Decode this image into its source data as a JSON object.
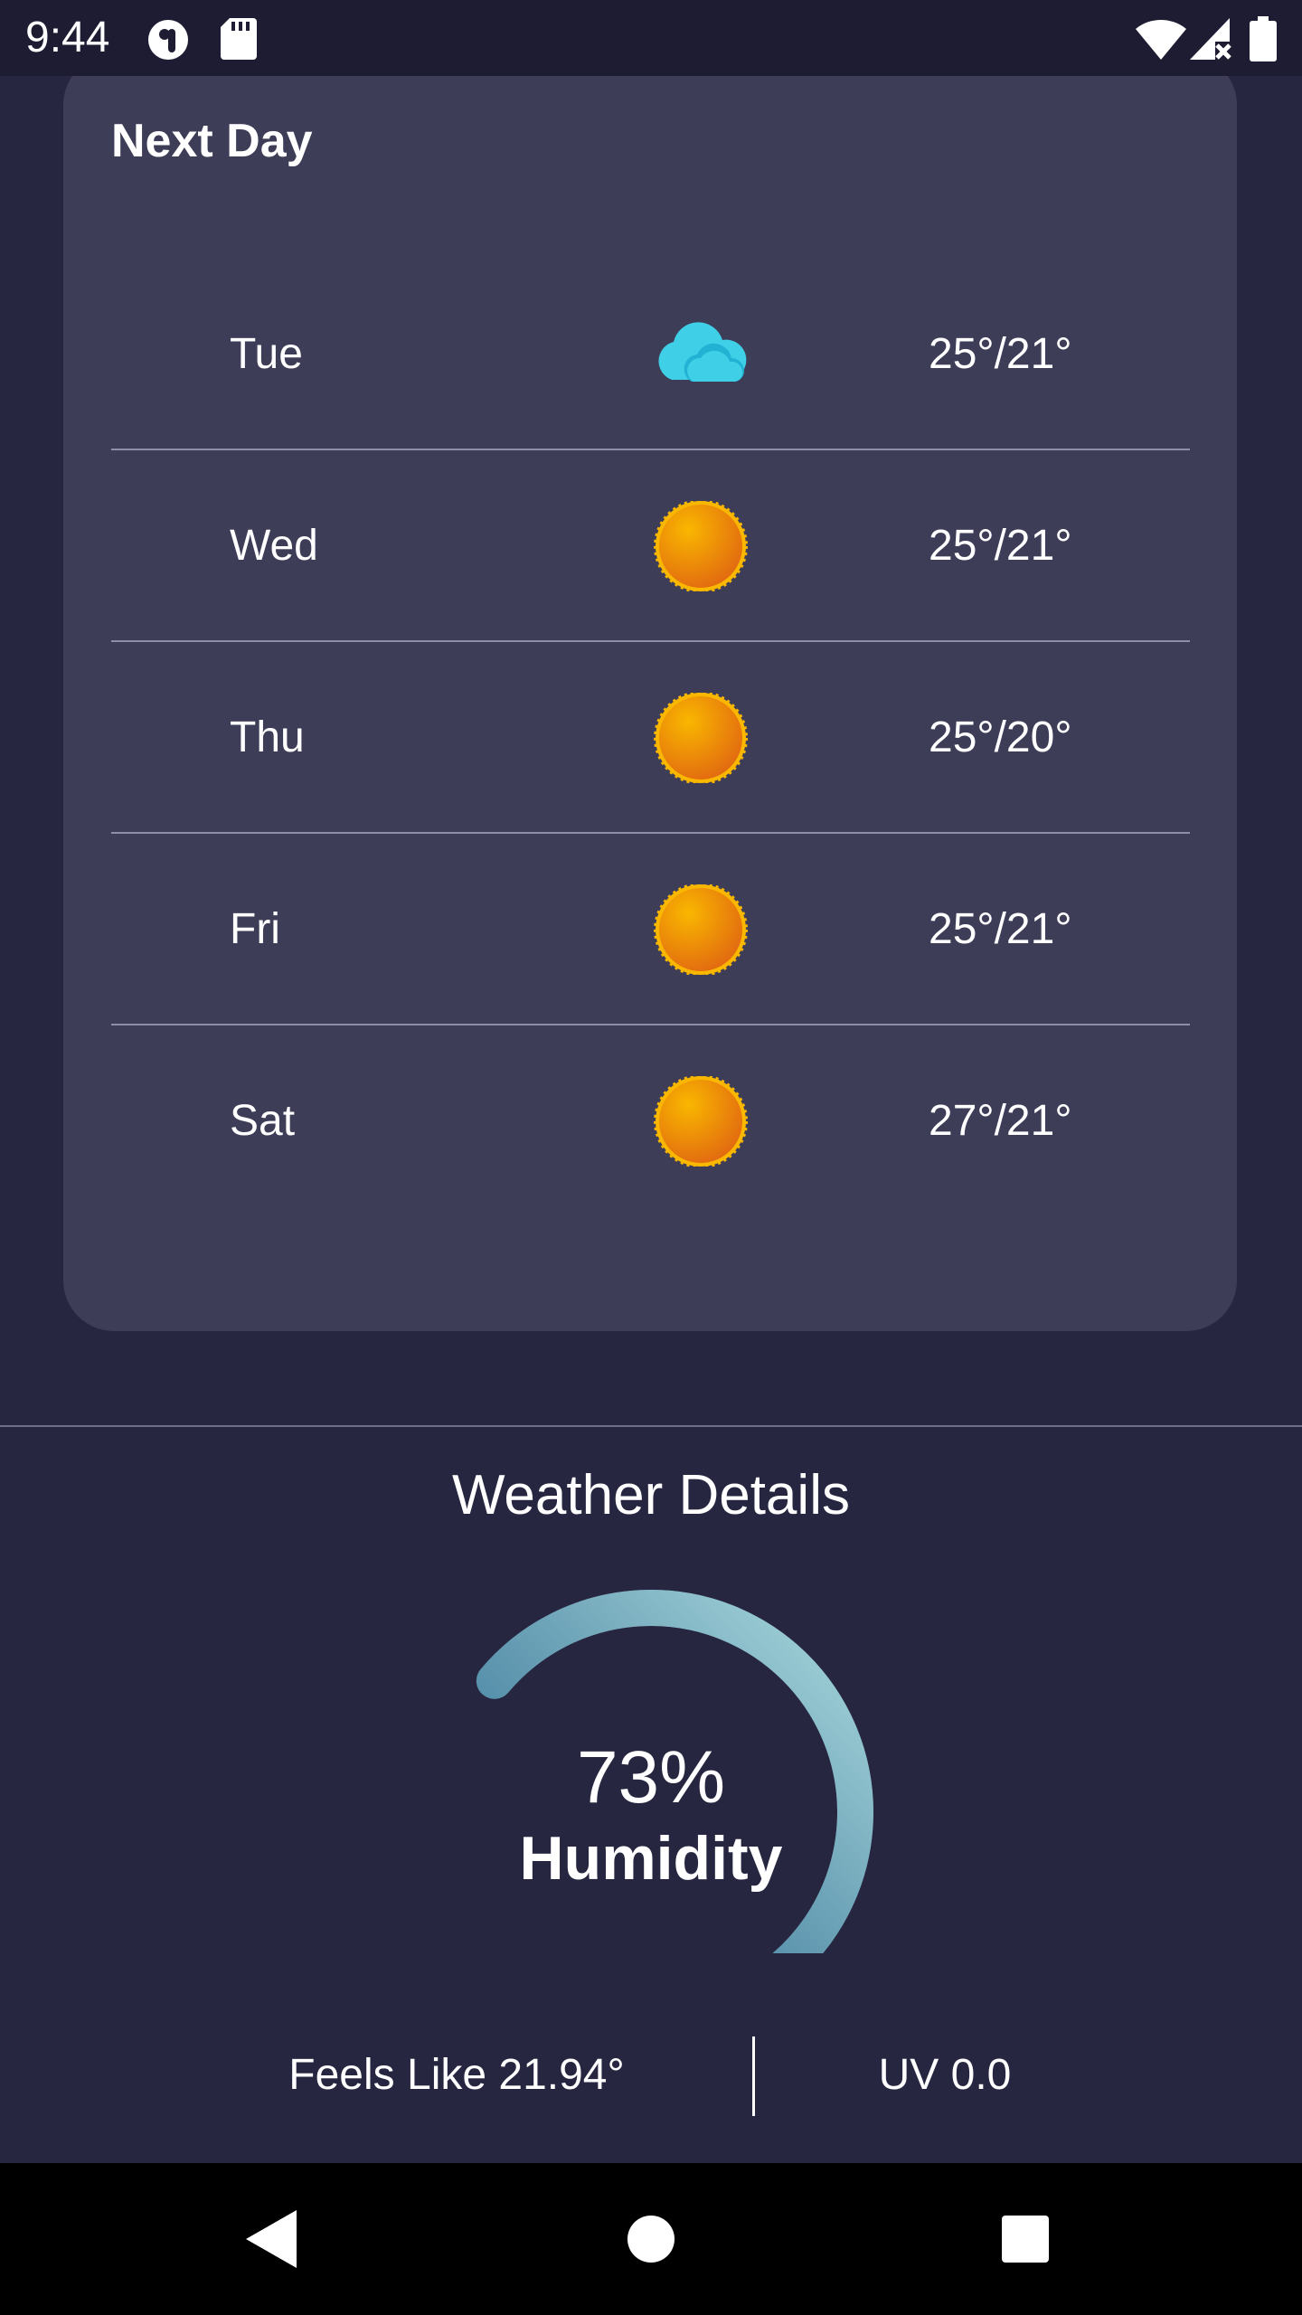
{
  "status_bar": {
    "time": "9:44",
    "icons": [
      "record-icon",
      "sd-card-icon",
      "wifi-icon",
      "cellular-no-signal-icon",
      "battery-icon"
    ]
  },
  "forecast": {
    "title": "Next Day",
    "days": [
      {
        "day": "Tue",
        "icon": "cloudy-icon",
        "temp": "25°/21°"
      },
      {
        "day": "Wed",
        "icon": "sunny-icon",
        "temp": "25°/21°"
      },
      {
        "day": "Thu",
        "icon": "sunny-icon",
        "temp": "25°/20°"
      },
      {
        "day": "Fri",
        "icon": "sunny-icon",
        "temp": "25°/21°"
      },
      {
        "day": "Sat",
        "icon": "sunny-icon",
        "temp": "27°/21°"
      }
    ]
  },
  "details": {
    "title": "Weather Details",
    "humidity_value": "73%",
    "humidity_label": "Humidity",
    "humidity_fraction": 0.73,
    "feels_like": "Feels Like 21.94°",
    "uv": "UV 0.0"
  },
  "colors": {
    "background": "#272640",
    "card": "#3e3d57",
    "gauge_track": "#5d6e85",
    "gauge_start": "#2b6a92",
    "gauge_end": "#a8d8dd",
    "sun_light": "#f9b700",
    "sun_dark": "#e26a10",
    "cloud": "#3fcfe7"
  },
  "nav_bar": {
    "buttons": [
      "back-icon",
      "home-icon",
      "recents-icon"
    ]
  }
}
